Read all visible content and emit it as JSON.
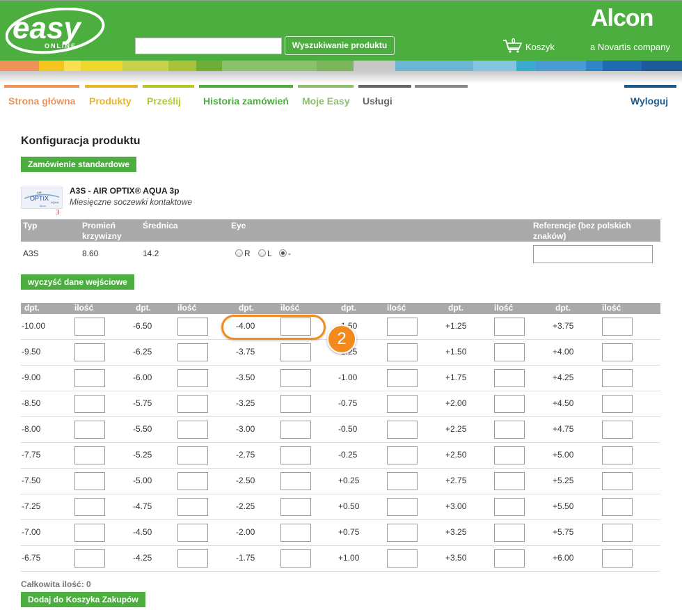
{
  "header": {
    "logo_text": "easy",
    "logo_sub": "ONLINE",
    "search_placeholder": "",
    "search_button": "Wyszukiwanie produktu",
    "cart_count": "0",
    "cart_label": "Koszyk",
    "brand": "Alcon",
    "tagline": "a Novartis company",
    "brand_green": "#4bae3f"
  },
  "nav": [
    {
      "label": "Strona główna",
      "color": "#f0935a"
    },
    {
      "label": "Produkty",
      "color": "#e8b52a"
    },
    {
      "label": "Prześlij",
      "color": "#b5c62b"
    },
    {
      "label": "Historia zamówień",
      "color": "#4bae3f"
    },
    {
      "label": "Moje Easy",
      "color": "#8cc06a"
    },
    {
      "label": "Usługi",
      "color": "#666666"
    },
    {
      "label": "Wyloguj",
      "color": "#1c5a8c"
    }
  ],
  "page": {
    "title": "Konfiguracja produktu",
    "standard_order_button": "Zamówienie standardowe",
    "product_image_number": "3",
    "product_name": "A3S - AIR OPTIX® AQUA 3p",
    "product_desc": "Miesięczne soczewki kontaktowe",
    "clear_button": "wyczyść dane wejściowe",
    "total_label": "Całkowita ilość: 0",
    "add_to_cart_button": "Dodaj do Koszyka Zakupów"
  },
  "product_table": {
    "headers": [
      "Typ",
      "Promień krzywizny",
      "Średnica",
      "Eye",
      "Referencje (bez polskich znaków)"
    ],
    "row": {
      "typ": "A3S",
      "radius": "8.60",
      "diameter": "14.2",
      "ref_value": ""
    },
    "eye_options": [
      {
        "label": "R",
        "checked": false
      },
      {
        "label": "L",
        "checked": false
      },
      {
        "label": "-",
        "checked": true
      }
    ]
  },
  "power_grid": {
    "col_header_dpt": "dpt.",
    "col_header_qty": "ilość",
    "columns": [
      [
        "-10.00",
        "-9.50",
        "-9.00",
        "-8.50",
        "-8.00",
        "-7.75",
        "-7.50",
        "-7.25",
        "-7.00",
        "-6.75"
      ],
      [
        "-6.50",
        "-6.25",
        "-6.00",
        "-5.75",
        "-5.50",
        "-5.25",
        "-5.00",
        "-4.75",
        "-4.50",
        "-4.25"
      ],
      [
        "-4.00",
        "-3.75",
        "-3.50",
        "-3.25",
        "-3.00",
        "-2.75",
        "-2.50",
        "-2.25",
        "-2.00",
        "-1.75"
      ],
      [
        "-1.50",
        "-1.25",
        "-1.00",
        "-0.75",
        "-0.50",
        "-0.25",
        "+0.25",
        "+0.50",
        "+0.75",
        "+1.00"
      ],
      [
        "+1.25",
        "+1.50",
        "+1.75",
        "+2.00",
        "+2.25",
        "+2.50",
        "+2.75",
        "+3.00",
        "+3.25",
        "+3.50"
      ],
      [
        "+3.75",
        "+4.00",
        "+4.25",
        "+4.50",
        "+4.75",
        "+5.00",
        "+5.25",
        "+5.50",
        "+5.75",
        "+6.00"
      ]
    ]
  },
  "annotation": {
    "badge": "2",
    "color": "#f28a1e"
  }
}
